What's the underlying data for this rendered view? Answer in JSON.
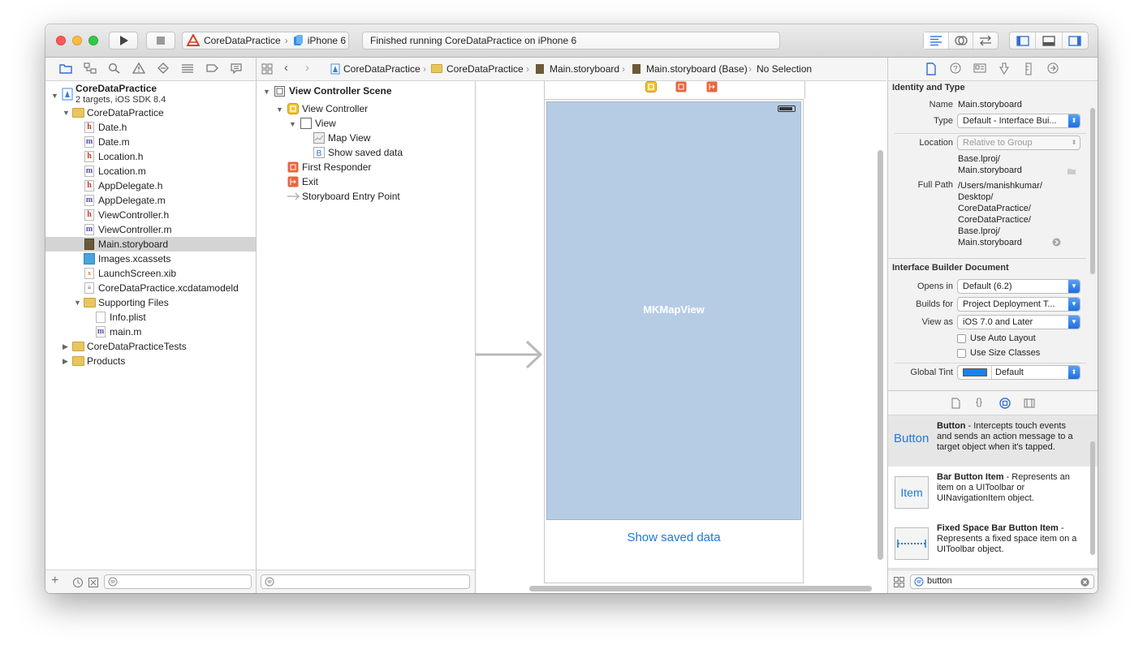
{
  "toolbar": {
    "scheme_target": "CoreDataPractice",
    "scheme_device": "iPhone 6",
    "activity_status": "Finished running CoreDataPractice on iPhone 6"
  },
  "navigator": {
    "project_name": "CoreDataPractice",
    "project_subtitle": "2 targets, iOS SDK 8.4",
    "items": [
      {
        "label": "CoreDataPractice",
        "kind": "folder"
      },
      {
        "label": "Date.h",
        "kind": "h"
      },
      {
        "label": "Date.m",
        "kind": "m"
      },
      {
        "label": "Location.h",
        "kind": "h"
      },
      {
        "label": "Location.m",
        "kind": "m"
      },
      {
        "label": "AppDelegate.h",
        "kind": "h"
      },
      {
        "label": "AppDelegate.m",
        "kind": "m"
      },
      {
        "label": "ViewController.h",
        "kind": "h"
      },
      {
        "label": "ViewController.m",
        "kind": "m"
      },
      {
        "label": "Main.storyboard",
        "kind": "storyboard"
      },
      {
        "label": "Images.xcassets",
        "kind": "assets"
      },
      {
        "label": "LaunchScreen.xib",
        "kind": "xib"
      },
      {
        "label": "CoreDataPractice.xcdatamodeld",
        "kind": "model"
      },
      {
        "label": "Supporting Files",
        "kind": "folder"
      },
      {
        "label": "Info.plist",
        "kind": "plist"
      },
      {
        "label": "main.m",
        "kind": "m"
      },
      {
        "label": "CoreDataPracticeTests",
        "kind": "folder"
      },
      {
        "label": "Products",
        "kind": "folder"
      }
    ]
  },
  "jumpbar": {
    "crumbs": [
      "CoreDataPractice",
      "CoreDataPractice",
      "Main.storyboard",
      "Main.storyboard (Base)",
      "No Selection"
    ]
  },
  "outline": {
    "scene": "View Controller Scene",
    "view_controller": "View Controller",
    "view": "View",
    "map_view": "Map View",
    "button": "Show saved data",
    "first_responder": "First Responder",
    "exit": "Exit",
    "entry_point": "Storyboard Entry Point"
  },
  "canvas": {
    "map_label": "MKMapView",
    "button_label": "Show saved data"
  },
  "inspector": {
    "identity_header": "Identity and Type",
    "name_label": "Name",
    "name_value": "Main.storyboard",
    "type_label": "Type",
    "type_value": "Default - Interface Bui...",
    "location_label": "Location",
    "location_value": "Relative to Group",
    "location_path_1": "Base.lproj/",
    "location_path_2": "Main.storyboard",
    "fullpath_label": "Full Path",
    "fullpath_lines": [
      "/Users/manishkumar/",
      "Desktop/",
      "CoreDataPractice/",
      "CoreDataPractice/",
      "Base.lproj/",
      "Main.storyboard"
    ],
    "ib_header": "Interface Builder Document",
    "opens_in_label": "Opens in",
    "opens_in_value": "Default (6.2)",
    "builds_for_label": "Builds for",
    "builds_for_value": "Project Deployment T...",
    "view_as_label": "View as",
    "view_as_value": "iOS 7.0 and Later",
    "auto_layout": "Use Auto Layout",
    "size_classes": "Use Size Classes",
    "global_tint_label": "Global Tint",
    "global_tint_value": "Default",
    "tint_color": "#1a82e6"
  },
  "library": {
    "items": [
      {
        "icon_text": "Button",
        "title": "Button",
        "desc": " - Intercepts touch events and sends an action message to a target object when it's tapped."
      },
      {
        "icon_text": "Item",
        "title": "Bar Button Item",
        "desc": " - Represents an item on a UIToolbar or UINavigationItem object."
      },
      {
        "icon_text": "",
        "title": "Fixed Space Bar Button Item",
        "desc": " - Represents a fixed space item on a UIToolbar object."
      }
    ],
    "filter_value": "button"
  },
  "colors": {
    "map_fill": "#b6cce4",
    "accent": "#1a7ae0"
  }
}
